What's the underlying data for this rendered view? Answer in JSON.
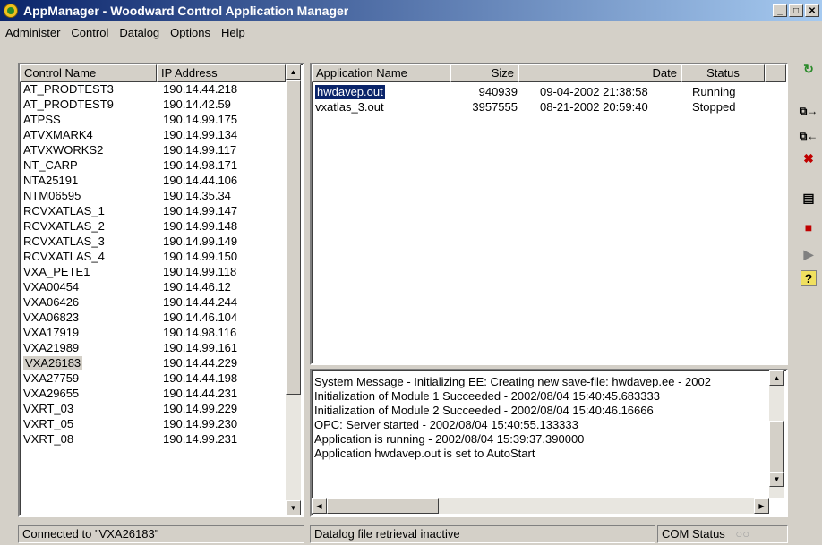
{
  "window": {
    "title": "AppManager - Woodward Control Application Manager"
  },
  "menu": [
    "Administer",
    "Control",
    "Datalog",
    "Options",
    "Help"
  ],
  "controls": {
    "headers": {
      "name": "Control Name",
      "ip": "IP Address"
    },
    "rows": [
      {
        "name": "AT_PRODTEST3",
        "ip": "190.14.44.218"
      },
      {
        "name": "AT_PRODTEST9",
        "ip": "190.14.42.59"
      },
      {
        "name": "ATPSS",
        "ip": "190.14.99.175"
      },
      {
        "name": "ATVXMARK4",
        "ip": "190.14.99.134"
      },
      {
        "name": "ATVXWORKS2",
        "ip": "190.14.99.117"
      },
      {
        "name": "NT_CARP",
        "ip": "190.14.98.171"
      },
      {
        "name": "NTA25191",
        "ip": "190.14.44.106"
      },
      {
        "name": "NTM06595",
        "ip": "190.14.35.34"
      },
      {
        "name": "RCVXATLAS_1",
        "ip": "190.14.99.147"
      },
      {
        "name": "RCVXATLAS_2",
        "ip": "190.14.99.148"
      },
      {
        "name": "RCVXATLAS_3",
        "ip": "190.14.99.149"
      },
      {
        "name": "RCVXATLAS_4",
        "ip": "190.14.99.150"
      },
      {
        "name": "VXA_PETE1",
        "ip": "190.14.99.118"
      },
      {
        "name": "VXA00454",
        "ip": "190.14.46.12"
      },
      {
        "name": "VXA06426",
        "ip": "190.14.44.244"
      },
      {
        "name": "VXA06823",
        "ip": "190.14.46.104"
      },
      {
        "name": "VXA17919",
        "ip": "190.14.98.116"
      },
      {
        "name": "VXA21989",
        "ip": "190.14.99.161"
      },
      {
        "name": "VXA26183",
        "ip": "190.14.44.229",
        "selected": true
      },
      {
        "name": "VXA27759",
        "ip": "190.14.44.198"
      },
      {
        "name": "VXA29655",
        "ip": "190.14.44.231"
      },
      {
        "name": "VXRT_03",
        "ip": "190.14.99.229"
      },
      {
        "name": "VXRT_05",
        "ip": "190.14.99.230"
      },
      {
        "name": "VXRT_08",
        "ip": "190.14.99.231"
      }
    ]
  },
  "applications": {
    "headers": {
      "name": "Application Name",
      "size": "Size",
      "date": "Date",
      "status": "Status"
    },
    "rows": [
      {
        "name": "hwdavep.out",
        "size": "940939",
        "date": "09-04-2002 21:38:58",
        "status": "Running",
        "selected": true
      },
      {
        "name": "vxatlas_3.out",
        "size": "3957555",
        "date": "08-21-2002 20:59:40",
        "status": "Stopped"
      }
    ]
  },
  "messages": [
    "System Message - Initializing EE: Creating new save-file: hwdavep.ee - 2002",
    "Initialization of Module 1 Succeeded - 2002/08/04 15:40:45.683333",
    "Initialization of Module 2 Succeeded - 2002/08/04 15:40:46.16666",
    "OPC: Server started - 2002/08/04 15:40:55.133333",
    "Application is running - 2002/08/04 15:39:37.390000",
    "Application hwdavep.out is set to AutoStart"
  ],
  "statusbar": {
    "connection": "Connected to \"VXA26183\"",
    "datalog": "Datalog file retrieval inactive",
    "com": "COM Status"
  },
  "colors": {
    "title_start": "#0a246a",
    "title_end": "#a6caf0",
    "selection": "#0a246a",
    "face": "#d4d0c8"
  }
}
